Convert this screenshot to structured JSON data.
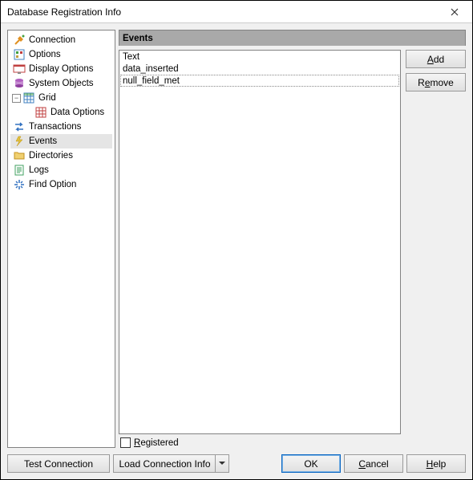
{
  "window": {
    "title": "Database Registration Info"
  },
  "nav": {
    "items": [
      {
        "id": "connection",
        "label": "Connection",
        "icon": "connection-icon"
      },
      {
        "id": "options",
        "label": "Options",
        "icon": "options-icon"
      },
      {
        "id": "display-options",
        "label": "Display Options",
        "icon": "display-options-icon"
      },
      {
        "id": "system-objects",
        "label": "System Objects",
        "icon": "system-objects-icon"
      },
      {
        "id": "grid",
        "label": "Grid",
        "icon": "grid-icon",
        "expanded": true
      },
      {
        "id": "data-options",
        "label": "Data Options",
        "icon": "data-options-icon",
        "parent": "grid"
      },
      {
        "id": "transactions",
        "label": "Transactions",
        "icon": "transactions-icon"
      },
      {
        "id": "events",
        "label": "Events",
        "icon": "events-icon",
        "selected": true
      },
      {
        "id": "directories",
        "label": "Directories",
        "icon": "directories-icon"
      },
      {
        "id": "logs",
        "label": "Logs",
        "icon": "logs-icon"
      },
      {
        "id": "find-option",
        "label": "Find Option",
        "icon": "find-option-icon"
      }
    ]
  },
  "section": {
    "title": "Events"
  },
  "events": {
    "items": [
      "Text",
      "data_inserted"
    ],
    "editing_value": "null_field_met"
  },
  "buttons": {
    "add": "Add",
    "remove": "Remove"
  },
  "registered": {
    "label": "Registered",
    "checked": false
  },
  "footer": {
    "test_connection": "Test Connection",
    "load_connection_info": "Load Connection Info",
    "ok": "OK",
    "cancel": "Cancel",
    "help": "Help"
  }
}
